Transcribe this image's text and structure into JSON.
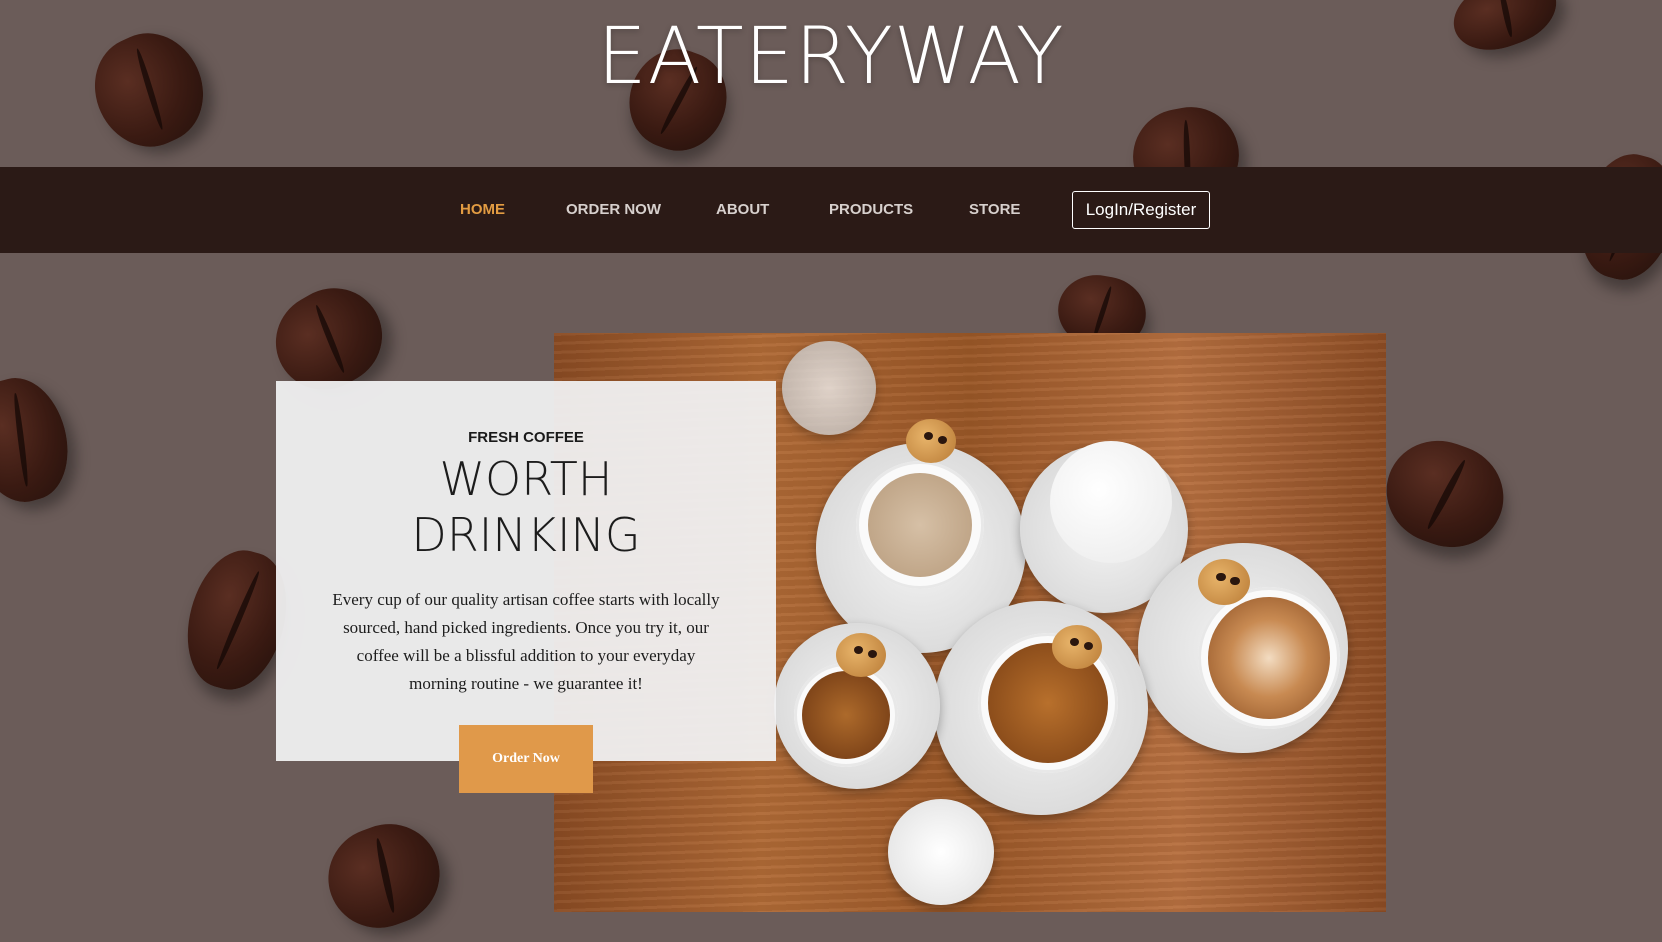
{
  "brand": {
    "name": "EATERYWAY"
  },
  "nav": {
    "items": [
      {
        "label": "HOME",
        "active": true
      },
      {
        "label": "ORDER NOW",
        "active": false
      },
      {
        "label": "ABOUT",
        "active": false
      },
      {
        "label": "PRODUCTS",
        "active": false
      },
      {
        "label": "STORE",
        "active": false
      }
    ],
    "login_label": "LogIn/Register"
  },
  "hero": {
    "eyebrow": "FRESH COFFEE",
    "headline_line1": "WORTH",
    "headline_line2": "DRINKING",
    "body": "Every cup of our quality artisan coffee starts with locally sourced, hand picked ingredients. Once you try it, our coffee will be a blissful addition to your everyday morning routine - we guarantee it!",
    "cta_label": "Order Now"
  },
  "colors": {
    "background": "#6b5c59",
    "navbar": "#2b1a16",
    "accent": "#e39c42",
    "button": "#e0994a",
    "card": "#f0f0f1"
  }
}
